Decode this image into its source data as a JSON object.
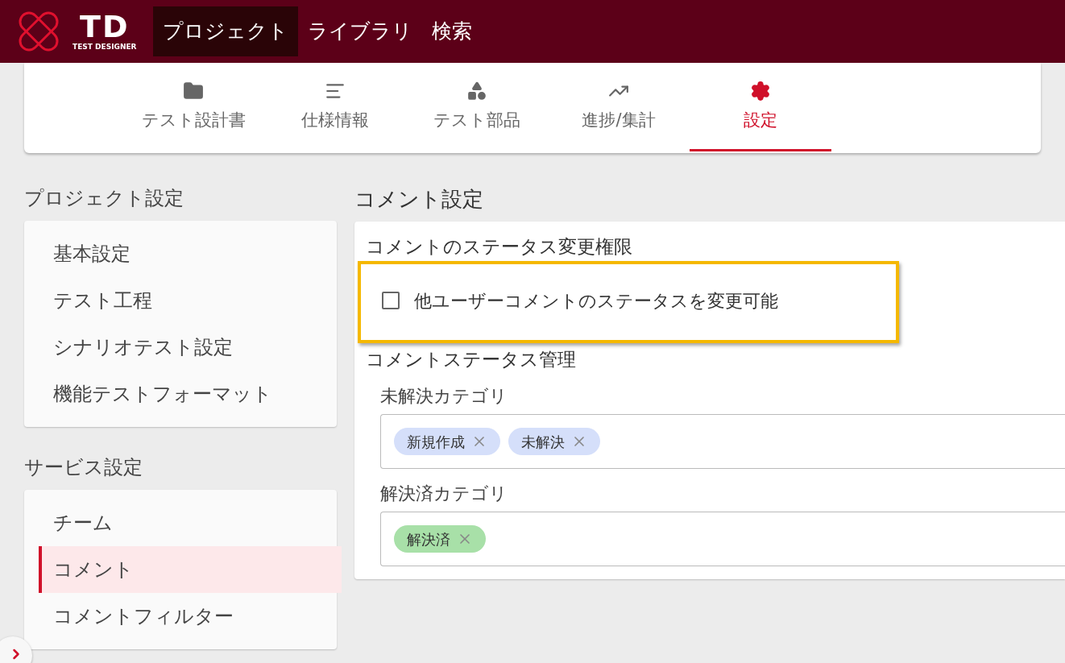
{
  "header": {
    "logo": {
      "mark": "TD",
      "subtitle": "TEST DESIGNER"
    },
    "nav": [
      {
        "label": "プロジェクト",
        "selected": true
      },
      {
        "label": "ライブラリ",
        "selected": false
      },
      {
        "label": "検索",
        "selected": false
      }
    ]
  },
  "tabs": [
    {
      "label": "テスト設計書",
      "selected": false
    },
    {
      "label": "仕様情報",
      "selected": false
    },
    {
      "label": "テスト部品",
      "selected": false
    },
    {
      "label": "進捗/集計",
      "selected": false
    },
    {
      "label": "設定",
      "selected": true
    }
  ],
  "sidebar": [
    {
      "title": "プロジェクト設定",
      "items": [
        {
          "label": "基本設定",
          "selected": false
        },
        {
          "label": "テスト工程",
          "selected": false
        },
        {
          "label": "シナリオテスト設定",
          "selected": false
        },
        {
          "label": "機能テストフォーマット",
          "selected": false
        }
      ]
    },
    {
      "title": "サービス設定",
      "items": [
        {
          "label": "チーム",
          "selected": false
        },
        {
          "label": "コメント",
          "selected": true
        },
        {
          "label": "コメントフィルター",
          "selected": false
        }
      ]
    }
  ],
  "content": {
    "title": "コメント設定",
    "permission": {
      "heading": "コメントのステータス変更権限",
      "highlighted": true,
      "checkbox": {
        "label": "他ユーザーコメントのステータスを変更可能",
        "checked": false
      }
    },
    "status_management": {
      "heading": "コメントステータス管理",
      "categories": [
        {
          "label": "未解決カテゴリ",
          "tags": [
            {
              "label": "新規作成",
              "color": "#d5dffa"
            },
            {
              "label": "未解決",
              "color": "#d5dffa"
            }
          ]
        },
        {
          "label": "解決済カテゴリ",
          "tags": [
            {
              "label": "解決済",
              "color": "#a8e0a8"
            }
          ]
        }
      ]
    }
  }
}
